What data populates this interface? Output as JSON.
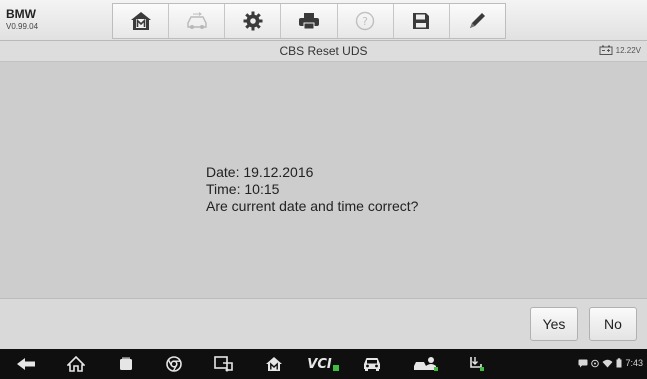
{
  "header": {
    "brand": "BMW",
    "version": "V0.99.04",
    "tools": [
      {
        "name": "home",
        "icon": "home-m-icon",
        "enabled": true
      },
      {
        "name": "vehicle-swap",
        "icon": "car-swap-icon",
        "enabled": false
      },
      {
        "name": "settings",
        "icon": "gear-icon",
        "enabled": true
      },
      {
        "name": "print",
        "icon": "printer-icon",
        "enabled": true
      },
      {
        "name": "help",
        "icon": "help-icon",
        "enabled": false
      },
      {
        "name": "save",
        "icon": "save-icon",
        "enabled": true
      },
      {
        "name": "data-logging",
        "icon": "pen-icon",
        "enabled": true
      }
    ]
  },
  "subheader": {
    "title": "CBS Reset UDS",
    "voltage": "12.22V"
  },
  "message": {
    "date_line": "Date: 19.12.2016",
    "time_line": "Time: 10:15",
    "question": "Are current date and time correct?"
  },
  "buttons": {
    "yes": "Yes",
    "no": "No"
  },
  "navbar": {
    "vcl_label": "VCI",
    "clock": "7:43",
    "icons": [
      "back-icon",
      "home-icon",
      "recents-icon",
      "chrome-icon",
      "shop-icon",
      "maxisys-home-icon",
      "vci-icon",
      "car-icon",
      "remote-expert-icon",
      "update-icon"
    ]
  },
  "colors": {
    "background": "#cdcdcd",
    "navbar": "#0f0f0f",
    "accent_green": "#3fbf3f"
  }
}
